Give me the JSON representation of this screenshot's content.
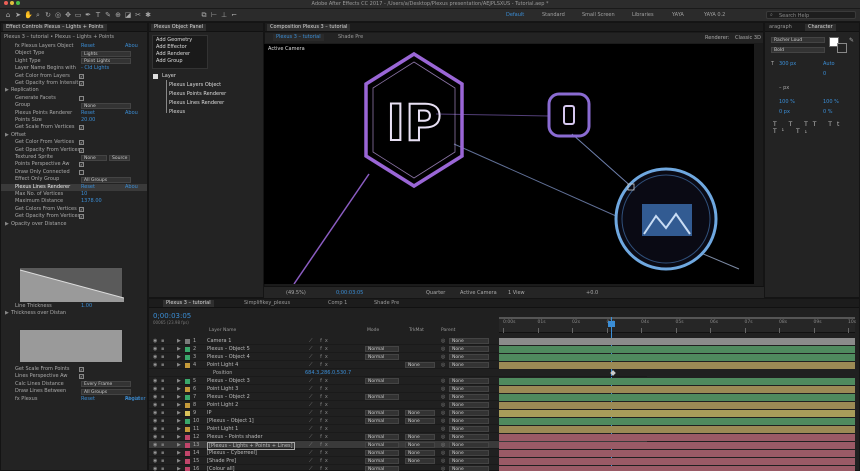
{
  "app": {
    "title": "Adobe After Effects CC 2017 - /Users/a/Desktop/Plexus presentation/AEJPLSXUS - Tutorial.aep *"
  },
  "workspaces": [
    "Default",
    "Standard",
    "Small Screen",
    "Libraries",
    "YAYA",
    "YAYA 0.2"
  ],
  "search": {
    "placeholder": "Search Help"
  },
  "effectControls": {
    "tab": "Effect Controls Plexus – Lights + Points",
    "breadcrumb": "Plexus 3 – tutorial • Plexus – Lights + Points",
    "rows": [
      {
        "k": "fx Plexus Layers Object",
        "v": "Reset",
        "v2": "Abou",
        "hdr": false
      },
      {
        "k": "Object Type",
        "v": "Lights",
        "sel": true
      },
      {
        "k": "Light Type",
        "v": "Point Lights",
        "sel": true
      },
      {
        "k": "Layer Name Begins with",
        "v": "- Cld Lights"
      },
      {
        "k": "Get Color from Layers",
        "chk": true
      },
      {
        "k": "Get Opacity from Intensit",
        "chk": true
      },
      {
        "k": "Replication",
        "tri": true
      },
      {
        "k": "Generate Facets",
        "chk": false
      },
      {
        "k": "Group",
        "v": "None",
        "sel": true
      },
      {
        "k": "Plexus Points Renderer",
        "v": "Reset",
        "v2": "Abou"
      },
      {
        "k": "Points Size",
        "v": "20.00"
      },
      {
        "k": "Get Scale From Vertices",
        "chk": true
      },
      {
        "k": "Offset",
        "tri": true
      },
      {
        "k": "Get Color From Vertices",
        "chk": true
      },
      {
        "k": "Get Opacity From Vertices",
        "chk": true
      },
      {
        "k": "Textured Sprite",
        "v": "None",
        "v3": "Source",
        "sel": true
      },
      {
        "k": "Points Perspective Aw",
        "chk": true
      },
      {
        "k": "Draw Only Connected",
        "chk": false
      },
      {
        "k": "Effect Only Group",
        "v": "All Groups",
        "sel": true
      },
      {
        "k": "Plexus Lines Renderer",
        "v": "Reset",
        "v2": "Abou",
        "hdr": true
      },
      {
        "k": "Max No. of Vertices",
        "v": "10"
      },
      {
        "k": "Maximum Distance",
        "v": "1378.00"
      },
      {
        "k": "Get Colors From Vertices",
        "chk": true
      },
      {
        "k": "Get Opacity From Vertices",
        "chk": true
      },
      {
        "k": "Opacity over Distance",
        "tri": true
      }
    ],
    "rows2": [
      {
        "k": "Line Thickness",
        "v": "1.00"
      },
      {
        "k": "Thickness over Distan",
        "tri": true
      }
    ],
    "rows3": [
      {
        "k": "Get Scale From Points",
        "chk": true
      },
      {
        "k": "Lines Perspective Aw",
        "chk": true
      },
      {
        "k": "Calc Lines Distance",
        "v": "Every Frame",
        "sel": true
      },
      {
        "k": "Draw Lines Between",
        "v": "All Groups",
        "sel": true
      },
      {
        "k": "fx Plexus",
        "v": "Reset",
        "v2": "Register",
        "v3": "About"
      }
    ]
  },
  "objectPanel": {
    "title": "Plexus Object Panel",
    "menu": [
      "Add Geometry",
      "Add Effector",
      "Add Renderer",
      "Add Group"
    ],
    "layerLabel": "Layer",
    "tree": [
      "Plexus Layers Object",
      "Plexus Points Renderer",
      "Plexus Lines Renderer",
      "Plexus"
    ]
  },
  "composition": {
    "tab": "Composition Plexus 3 – tutorial",
    "subtabs": [
      "Plexus 3 – tutorial",
      "Shade Pre"
    ],
    "renderer": "Renderer:",
    "rendererValue": "Classic 3D",
    "cameraLabel": "Active Camera",
    "footer": {
      "zoom": "(49.5%)",
      "time": "0;00:03:05",
      "quality": "Quarter",
      "camera": "Active Camera",
      "view": "1 View",
      "exposure": "+0.0"
    },
    "iconText": "IP"
  },
  "character": {
    "tabs": [
      "aragraph",
      "Character"
    ],
    "font": "Racher Loud",
    "style": "Bold",
    "size": "300 px",
    "leading": "Auto",
    "tracking": "0",
    "unit": "– px",
    "scaleV": "100 %",
    "scaleH": "100 %",
    "baseline": "0 px",
    "tsume": "0 %"
  },
  "timeline": {
    "tabs": [
      "Plexus 3 – tutorial",
      "Simplifikey_plexus",
      "Comp 1",
      "Shade Pre"
    ],
    "time": "0;00:03:05",
    "fps": "00065 (23.98 fps)",
    "cols": [
      "Layer Name",
      "Mode",
      "TrkMat",
      "Parent"
    ],
    "ticks": [
      "0:00s",
      "01s",
      "02s",
      "03s",
      "04s",
      "05s",
      "06s",
      "07s",
      "08s",
      "09s",
      "10s"
    ],
    "position": {
      "label": "Position",
      "value": "684.3,286.0,530.7"
    },
    "layers": [
      {
        "n": "1",
        "name": "Camera 1",
        "mode": "",
        "trk": "",
        "parent": "None",
        "color": "#7a7a7a",
        "bar": "#8b8b8b"
      },
      {
        "n": "2",
        "name": "Plexus – Object 5",
        "mode": "Normal",
        "trk": "",
        "parent": "None",
        "color": "#3aa86b",
        "bar": "#4f8a5e"
      },
      {
        "n": "3",
        "name": "Plexus – Object 4",
        "mode": "Normal",
        "trk": "",
        "parent": "None",
        "color": "#3aa86b",
        "bar": "#4f8a5e"
      },
      {
        "n": "4",
        "name": "Point Light 4",
        "mode": "",
        "trk": "None",
        "parent": "None",
        "color": "#c49a3a",
        "bar": "#9b8a55"
      },
      {
        "n": "5",
        "name": "Plexus – Object 3",
        "mode": "Normal",
        "trk": "",
        "parent": "None",
        "color": "#3aa86b",
        "bar": "#4f8a5e"
      },
      {
        "n": "6",
        "name": "Point Light 3",
        "mode": "",
        "trk": "",
        "parent": "None",
        "color": "#c49a3a",
        "bar": "#9b8a55"
      },
      {
        "n": "7",
        "name": "Plexus – Object 2",
        "mode": "Normal",
        "trk": "",
        "parent": "None",
        "color": "#3aa86b",
        "bar": "#4f8a5e"
      },
      {
        "n": "8",
        "name": "Point Light 2",
        "mode": "",
        "trk": "",
        "parent": "None",
        "color": "#c49a3a",
        "bar": "#9b8a55"
      },
      {
        "n": "9",
        "name": "IP",
        "mode": "Normal",
        "trk": "None",
        "parent": "None",
        "color": "#d9c25a",
        "bar": "#a89d5a"
      },
      {
        "n": "10",
        "name": "[Plexus – Object 1]",
        "mode": "Normal",
        "trk": "None",
        "parent": "None",
        "color": "#3aa86b",
        "bar": "#4f8a5e"
      },
      {
        "n": "11",
        "name": "Point Light 1",
        "mode": "",
        "trk": "",
        "parent": "None",
        "color": "#c49a3a",
        "bar": "#9b8a55"
      },
      {
        "n": "12",
        "name": "Plexus – Points shader",
        "mode": "Normal",
        "trk": "None",
        "parent": "None",
        "color": "#c0456a",
        "bar": "#9a5a66"
      },
      {
        "n": "13",
        "name": "[Plexus – Lights + Points + Lines]",
        "mode": "Normal",
        "trk": "None",
        "parent": "None",
        "color": "#c0456a",
        "bar": "#9a5a66"
      },
      {
        "n": "14",
        "name": "[Plexus – Cyberreel]",
        "mode": "Normal",
        "trk": "None",
        "parent": "None",
        "color": "#c0456a",
        "bar": "#9a5a66"
      },
      {
        "n": "15",
        "name": "[Shade Pre]",
        "mode": "Normal",
        "trk": "None",
        "parent": "None",
        "color": "#c0456a",
        "bar": "#9a5a66"
      },
      {
        "n": "16",
        "name": "[Colour all]",
        "mode": "Normal",
        "trk": "",
        "parent": "None",
        "color": "#c0456a",
        "bar": "#9a5a66"
      }
    ]
  },
  "colors": {
    "accent": "#3b8ed6",
    "purple": "#8e5bc4",
    "blue": "#4aa3e0"
  }
}
